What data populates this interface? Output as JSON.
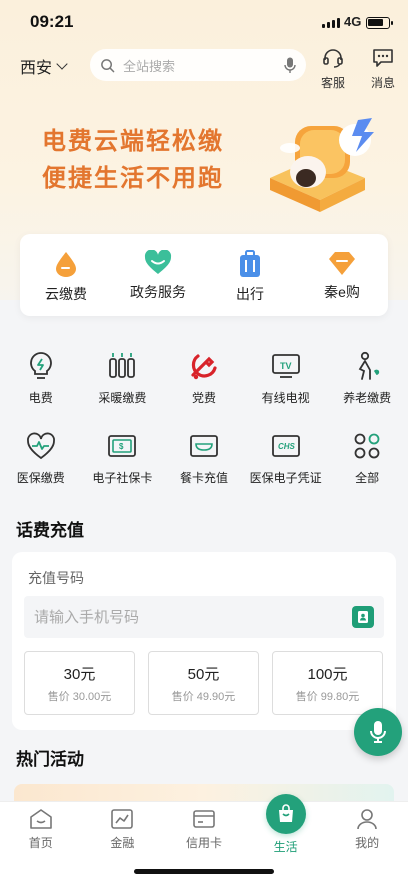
{
  "status_bar": {
    "time": "09:21",
    "network": "4G"
  },
  "header": {
    "city": "西安",
    "search_placeholder": "全站搜索",
    "service_label": "客服",
    "message_label": "消息"
  },
  "banner": {
    "line1": "电费云端轻松缴",
    "line2": "便捷生活不用跑"
  },
  "quick_access": [
    {
      "label": "云缴费",
      "icon": "drop-icon"
    },
    {
      "label": "政务服务",
      "icon": "heart-icon"
    },
    {
      "label": "出行",
      "icon": "luggage-icon"
    },
    {
      "label": "秦e购",
      "icon": "diamond-icon"
    }
  ],
  "service_grid": [
    {
      "label": "电费",
      "icon": "bulb-icon"
    },
    {
      "label": "采暖缴费",
      "icon": "radiator-icon"
    },
    {
      "label": "党费",
      "icon": "party-emblem-icon"
    },
    {
      "label": "有线电视",
      "icon": "tv-icon"
    },
    {
      "label": "养老缴费",
      "icon": "elderly-icon"
    },
    {
      "label": "医保缴费",
      "icon": "pulse-heart-icon"
    },
    {
      "label": "电子社保卡",
      "icon": "social-card-icon"
    },
    {
      "label": "餐卡充值",
      "icon": "meal-card-icon"
    },
    {
      "label": "医保电子凭证",
      "icon": "chs-card-icon"
    },
    {
      "label": "全部",
      "icon": "all-icon"
    }
  ],
  "recharge": {
    "title": "话费充值",
    "field_label": "充值号码",
    "phone_placeholder": "请输入手机号码",
    "amounts": [
      {
        "value": "30元",
        "price": "售价 30.00元"
      },
      {
        "value": "50元",
        "price": "售价 49.90元"
      },
      {
        "value": "100元",
        "price": "售价 99.80元"
      }
    ]
  },
  "hot": {
    "title": "热门活动"
  },
  "tabbar": [
    {
      "label": "首页",
      "icon": "home-icon"
    },
    {
      "label": "金融",
      "icon": "chart-icon"
    },
    {
      "label": "信用卡",
      "icon": "credit-card-icon"
    },
    {
      "label": "生活",
      "icon": "shopping-bag-icon",
      "active": true
    },
    {
      "label": "我的",
      "icon": "user-icon"
    }
  ],
  "colors": {
    "accent": "#23a17b",
    "banner_text": "#e3762f"
  }
}
